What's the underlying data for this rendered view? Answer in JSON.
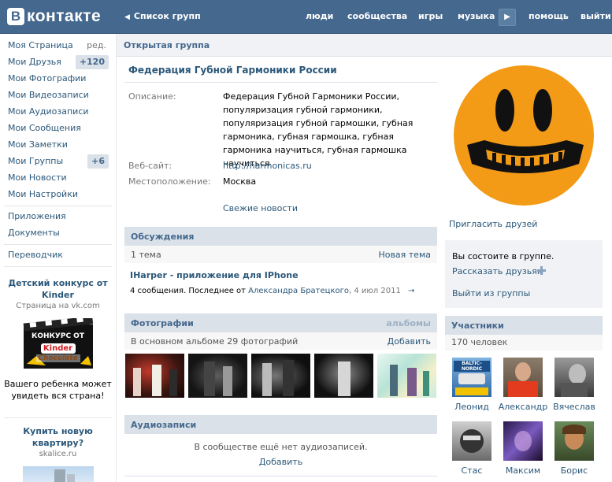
{
  "header": {
    "logo_letter": "В",
    "logo_text": "контакте",
    "back_label": "Список групп",
    "nav": [
      "люди",
      "сообщества",
      "игры",
      "музыка",
      "помощь",
      "выйти"
    ]
  },
  "left_menu": {
    "items": [
      {
        "label": "Моя Страница",
        "extra": "ред."
      },
      {
        "label": "Мои Друзья",
        "badge": "+120"
      },
      {
        "label": "Мои Фотографии"
      },
      {
        "label": "Мои Видеозаписи"
      },
      {
        "label": "Мои Аудиозаписи"
      },
      {
        "label": "Мои Сообщения"
      },
      {
        "label": "Мои Заметки"
      },
      {
        "label": "Мои Группы",
        "badge": "+6"
      },
      {
        "label": "Мои Новости"
      },
      {
        "label": "Мои Настройки"
      }
    ],
    "apps": [
      "Приложения",
      "Документы"
    ],
    "translator": "Переводчик"
  },
  "ads": [
    {
      "title": "Детский конкурс от Kinder",
      "source": "Страница на vk.com",
      "image_top": "КОНКУРС ОТ",
      "image_brand": "Kinder",
      "image_brand2": "Chocolate",
      "text": "Вашего ребенка может увидеть вся страна!"
    },
    {
      "title": "Купить новую квартиру?",
      "source": "skalice.ru"
    }
  ],
  "page": {
    "title": "Открытая группа",
    "group_name": "Федерация Губной Гармоники России",
    "info": {
      "desc_label": "Описание:",
      "desc_value": "Федерация Губной Гармоники России, популяризация губной гармоники, популяризация губной гармошки, губная гармоника, губная гармошка, губная гармоника научиться, губная гармошка научиться",
      "site_label": "Веб-сайт:",
      "site_value": "http://harmonicas.ru",
      "loc_label": "Местоположение:",
      "loc_value": "Москва",
      "fresh_news": "Свежие новости"
    },
    "discussions": {
      "title": "Обсуждения",
      "count": "1 тема",
      "new_topic": "Новая тема",
      "topic_title": "IHarper - приложение для IPhone",
      "topic_meta_prefix": "4 сообщения. Последнее от ",
      "topic_author": "Александра Братецкого",
      "topic_date": ", 4 июл 2011",
      "arrow": "→"
    },
    "photos": {
      "title": "Фотографии",
      "albums": "альбомы",
      "count": "В основном альбоме 29 фотографий",
      "add": "Добавить"
    },
    "audio": {
      "title": "Аудиозаписи",
      "empty": "В сообществе ещё нет аудиозаписей.",
      "add": "Добавить"
    }
  },
  "right": {
    "invite": "Пригласить друзей",
    "member_status": "Вы состоите в группе.",
    "tell_friends": "Рассказать друзьям",
    "leave": "Выйти из группы",
    "members_title": "Участники",
    "members_count": "170 человек",
    "members": [
      "Леонид",
      "Александр",
      "Вячеслав",
      "Стас",
      "Максим",
      "Борис"
    ],
    "member1_badge": "BALTIC-NORDIC"
  },
  "colors": {
    "header": "#45688e",
    "link": "#2b587a",
    "section_bg": "#dae1e8",
    "avatar_orange": "#f39b16"
  }
}
